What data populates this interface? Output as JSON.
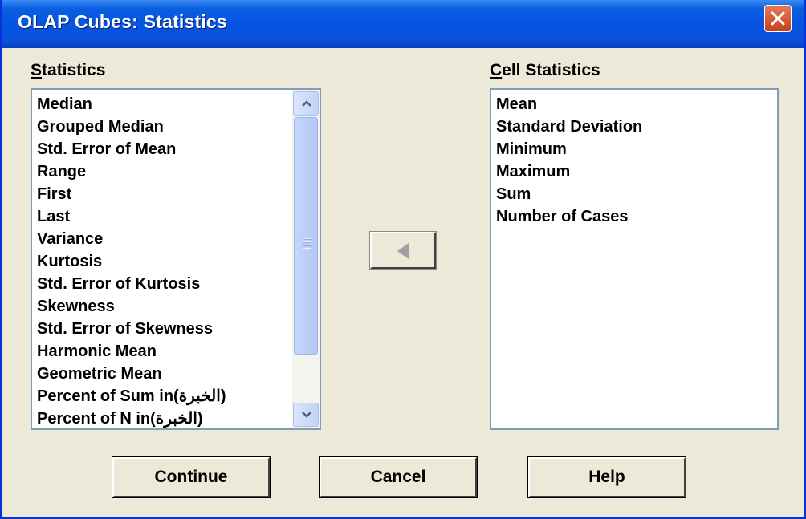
{
  "window": {
    "title": "OLAP Cubes: Statistics"
  },
  "statistics": {
    "label_mnemonic": "S",
    "label_rest": "tatistics",
    "items": [
      "Median",
      "Grouped Median",
      "Std. Error of Mean",
      "Range",
      "First",
      "Last",
      "Variance",
      "Kurtosis",
      "Std. Error of Kurtosis",
      "Skewness",
      "Std. Error of Skewness",
      "Harmonic Mean",
      "Geometric Mean",
      "Percent of Sum in(الخبرة)",
      "Percent of N in(الخبرة)"
    ]
  },
  "cell_statistics": {
    "label_mnemonic": "C",
    "label_rest": "ell Statistics",
    "items": [
      "Mean",
      "Standard Deviation",
      "Minimum",
      "Maximum",
      "Sum",
      "Number of Cases"
    ]
  },
  "buttons": {
    "continue": "Continue",
    "cancel": "Cancel",
    "help": "Help"
  },
  "icons": {
    "close": "close-icon",
    "move": "arrow-left-icon",
    "scroll_up": "scroll-up-icon",
    "scroll_down": "scroll-down-icon"
  }
}
